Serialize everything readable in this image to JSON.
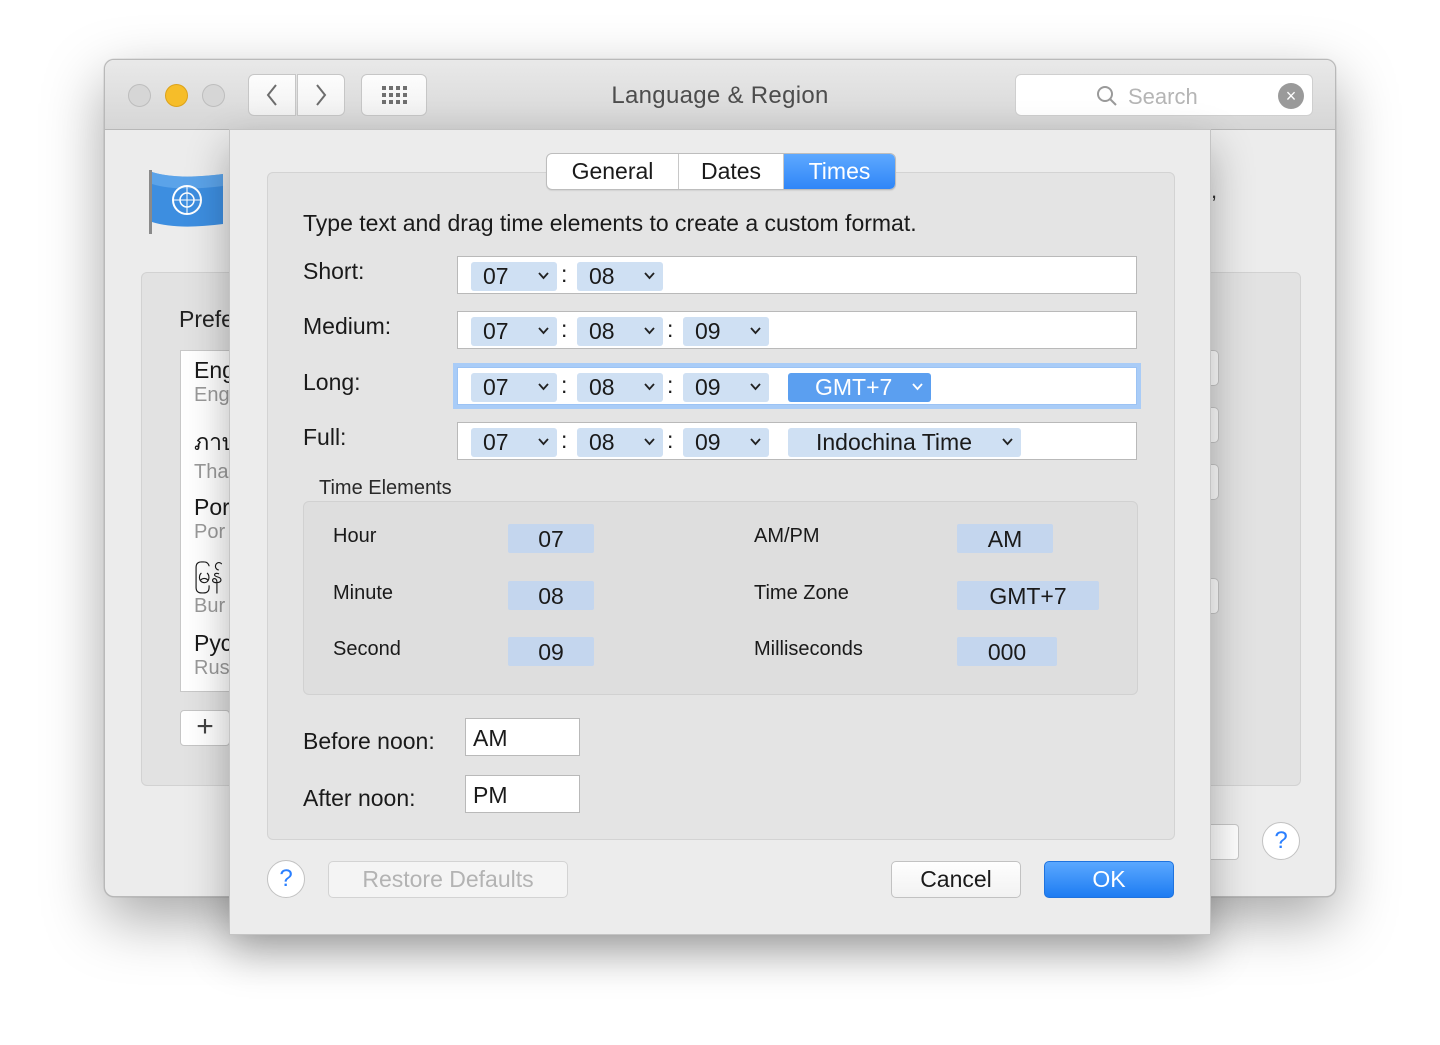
{
  "window": {
    "title": "Language & Region",
    "search_placeholder": "Search"
  },
  "background": {
    "preferred_label": "Prefe",
    "comma": ",",
    "languages": [
      {
        "name": "Eng",
        "sub": "Eng"
      },
      {
        "name": "ภาษ",
        "sub": "Tha"
      },
      {
        "name": "Por",
        "sub": "Por"
      },
      {
        "name": "မြန်",
        "sub": "Bur"
      },
      {
        "name": "Рус",
        "sub": "Rus"
      }
    ],
    "add_label": "+",
    "help_label": "?"
  },
  "sheet": {
    "tabs": [
      "General",
      "Dates",
      "Times"
    ],
    "selected_tab": "Times",
    "instruction": "Type text and drag time elements to create a custom format.",
    "formats": {
      "short": {
        "label": "Short:",
        "hour": "07",
        "minute": "08"
      },
      "medium": {
        "label": "Medium:",
        "hour": "07",
        "minute": "08",
        "second": "09"
      },
      "long": {
        "label": "Long:",
        "hour": "07",
        "minute": "08",
        "second": "09",
        "zone": "GMT+7"
      },
      "full": {
        "label": "Full:",
        "hour": "07",
        "minute": "08",
        "second": "09",
        "zone": "Indochina Time"
      }
    },
    "separator": ":",
    "time_elements": {
      "label": "Time Elements",
      "hour": {
        "label": "Hour",
        "value": "07"
      },
      "minute": {
        "label": "Minute",
        "value": "08"
      },
      "second": {
        "label": "Second",
        "value": "09"
      },
      "ampm": {
        "label": "AM/PM",
        "value": "AM"
      },
      "timezone": {
        "label": "Time Zone",
        "value": "GMT+7"
      },
      "milliseconds": {
        "label": "Milliseconds",
        "value": "000"
      }
    },
    "before_noon": {
      "label": "Before noon:",
      "value": "AM"
    },
    "after_noon": {
      "label": "After noon:",
      "value": "PM"
    },
    "buttons": {
      "help": "?",
      "restore": "Restore Defaults",
      "cancel": "Cancel",
      "ok": "OK"
    }
  },
  "colors": {
    "accent": "#2f86f7",
    "token": "#cfe0f3",
    "token_selected": "#5b9ff0",
    "minimize": "#f6bd29"
  }
}
